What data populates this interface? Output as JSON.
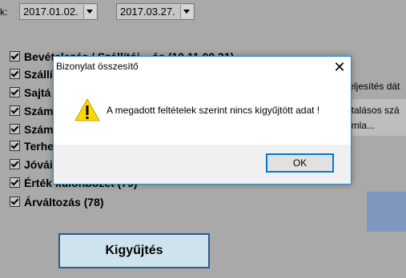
{
  "background": {
    "label": "k:",
    "date_from": "2017.01.02.",
    "date_to": "2017.03.27.",
    "checkbox_items": [
      "Bevételezés / Szállítói ...ás (10.11.00.31)",
      "Szállí",
      "Sajtá",
      "Szám",
      "Szám",
      "Terhe",
      "Jóvái",
      "Érték különbözet (79)",
      "Árváltozás (78)"
    ],
    "right_text": [
      "teljesítés dát",
      "utalásos szá",
      "ámla..."
    ],
    "collect_button": "Kigyűjtés"
  },
  "dialog": {
    "title": "Bizonylat összesítő",
    "close_icon": "close-icon",
    "warning_icon": "warning-icon",
    "message": "A megadott feltételek szerint nincs kigyűjtött adat !",
    "ok_label": "OK"
  }
}
